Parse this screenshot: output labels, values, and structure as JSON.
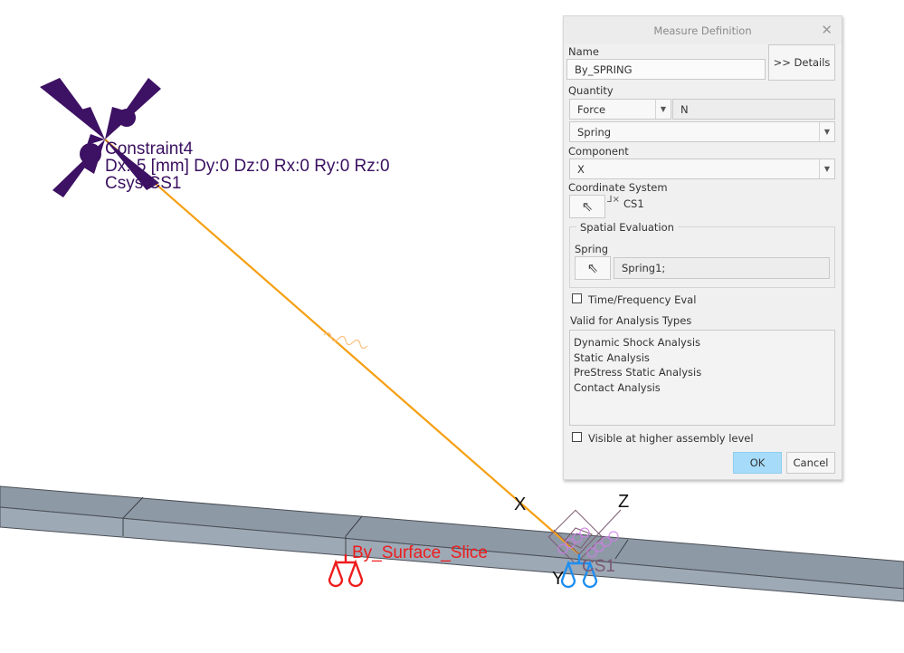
{
  "viewport": {
    "constraint_label": {
      "name": "Constraint4",
      "values": "Dx:-5 [mm] Dy:0 Dz:0 Rx:0 Ry:0 Rz:0",
      "csys": "Csys:CS1"
    },
    "measure_label": "By_Surface_Slice",
    "csys_label": "CS1",
    "axis_labels": {
      "x": "X",
      "y": "Y",
      "z": "Z"
    },
    "colors": {
      "constraint": "#3a1060",
      "spring": "#f5a015",
      "beam_top": "#8f9aa8",
      "beam_side": "#9ea9b6",
      "measure_red": "#ee1c1c",
      "measure_blue": "#1e8ef0"
    }
  },
  "dialog": {
    "title": "Measure Definition",
    "close_icon": "close-x",
    "name_label": "Name",
    "name_value": "By_SPRING",
    "details_button": ">> Details",
    "quantity_label": "Quantity",
    "quantity_value": "Force",
    "unit_value": "N",
    "type_value": "Spring",
    "component_label": "Component",
    "component_value": "X",
    "coordinate_system_label": "Coordinate System",
    "coordinate_system_value": "CS1",
    "spatial_evaluation_label": "Spatial Evaluation",
    "spring_label": "Spring",
    "spring_value": "Spring1;",
    "time_frequency_label": "Time/Frequency Eval",
    "time_frequency_checked": false,
    "valid_types_label": "Valid for Analysis Types",
    "valid_types": [
      "Dynamic Shock Analysis",
      "Static Analysis",
      "PreStress Static Analysis",
      "Contact Analysis"
    ],
    "visible_higher_label": "Visible at higher assembly level",
    "visible_higher_checked": false,
    "ok_button": "OK",
    "cancel_button": "Cancel"
  }
}
